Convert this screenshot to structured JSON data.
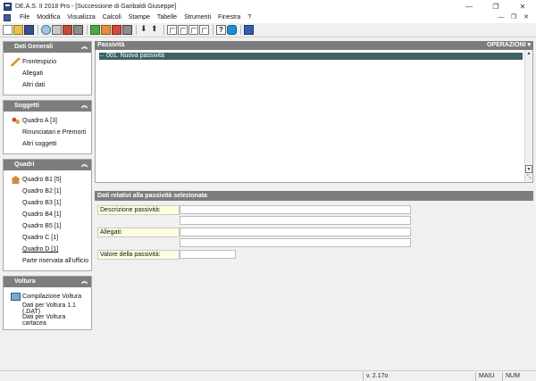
{
  "window": {
    "title": "DE.A.S. II 2018 Pro - [Successione di Garibaldi Giuseppe]",
    "controls": [
      "—",
      "❐",
      "✕"
    ]
  },
  "menubar": {
    "items": [
      "File",
      "Modifica",
      "Visualizza",
      "Calcoli",
      "Stampe",
      "Tabelle",
      "Strumenti",
      "Finestra",
      "?"
    ],
    "mdi_controls": [
      "—",
      "❐",
      "✕"
    ]
  },
  "toolbar": {
    "buttons": [
      "new-icon",
      "open-icon",
      "save-icon",
      "search-icon",
      "print-icon",
      "print-doc-icon",
      "copy-icon",
      "green-icon",
      "orange-icon",
      "red-icon",
      "download-icon",
      "upload-icon",
      "grid-icon",
      "table-icon",
      "calc-icon",
      "report-icon",
      "help-icon",
      "skype-icon",
      "book-icon"
    ]
  },
  "sidebar": {
    "panels": [
      {
        "title": "Dati Generali",
        "items": [
          {
            "label": "Frontespizio",
            "icon": "pen-icon"
          },
          {
            "label": "Allegati",
            "icon": ""
          },
          {
            "label": "Altri dati",
            "icon": ""
          }
        ]
      },
      {
        "title": "Soggetti",
        "items": [
          {
            "label": "Quadro A [3]",
            "icon": "people-icon"
          },
          {
            "label": "Rinunciatari e Premorti",
            "icon": ""
          },
          {
            "label": "Altri soggetti",
            "icon": ""
          }
        ]
      },
      {
        "title": "Quadri",
        "items": [
          {
            "label": "Quadro B1 [5]",
            "icon": "house-icon"
          },
          {
            "label": "Quadro B2 [1]",
            "icon": ""
          },
          {
            "label": "Quadro B3 [1]",
            "icon": ""
          },
          {
            "label": "Quadro B4 [1]",
            "icon": ""
          },
          {
            "label": "Quadro B5 [1]",
            "icon": ""
          },
          {
            "label": "Quadro C [1]",
            "icon": ""
          },
          {
            "label": "Quadro D [1]",
            "icon": ""
          },
          {
            "label": "Parte riservata all'ufficio",
            "icon": ""
          }
        ]
      },
      {
        "title": "Voltura",
        "items": [
          {
            "label": "Compilazione Voltura",
            "icon": "monitor-icon"
          },
          {
            "label": "Dati per Voltura 1.1 (.DAT)",
            "icon": ""
          },
          {
            "label": "Dati per Voltura cartacea",
            "icon": ""
          }
        ]
      }
    ]
  },
  "passivita": {
    "header": "Passività",
    "operations": "OPERAZIONI ▾",
    "rows": [
      "001. Nuova passività"
    ]
  },
  "detail": {
    "header": "Dati relativi alla passività selezionata",
    "fields": {
      "descrizione_label": "Descrizione passività:",
      "allegati_label": "Allegati:",
      "valore_label": "Valore della passività:"
    }
  },
  "statusbar": {
    "version": "v. 2.17o",
    "caps": "MAIU",
    "num": "NUM"
  }
}
